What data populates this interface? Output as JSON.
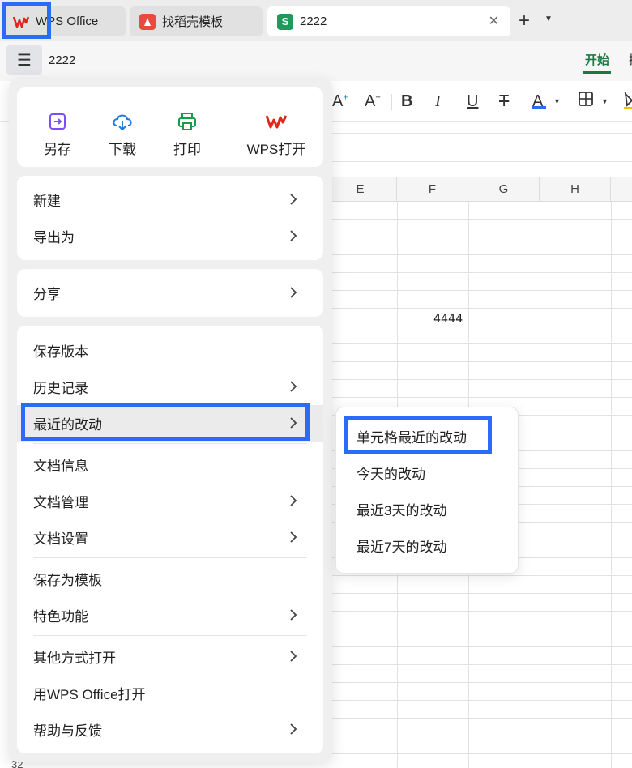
{
  "tabs": [
    {
      "label": "WPS Office",
      "icon": "wps-logo-icon",
      "active": false
    },
    {
      "label": "找稻壳模板",
      "icon": "docer-icon",
      "active": false
    },
    {
      "label": "2222",
      "icon": "spreadsheet-icon",
      "icon_text": "S",
      "active": true
    }
  ],
  "new_tab_symbol": "+",
  "doc_title": "2222",
  "ribbon": {
    "start_tab": "开始",
    "next_tab": "插"
  },
  "colors": {
    "accent": "#2b6cf6",
    "brand_green": "#1a7a43",
    "wps_red": "#e0251b",
    "sheet_green": "#1e9b5a"
  },
  "columns": [
    "E",
    "F",
    "G",
    "H"
  ],
  "cell_value": "4444",
  "row_number": "32",
  "menu": {
    "quick_actions": [
      {
        "label": "另存",
        "icon": "save-as-icon"
      },
      {
        "label": "下载",
        "icon": "download-cloud-icon"
      },
      {
        "label": "打印",
        "icon": "printer-icon"
      },
      {
        "label": "WPS打开",
        "icon": "wps-open-icon"
      }
    ],
    "group1": [
      {
        "label": "新建",
        "submenu": true
      },
      {
        "label": "导出为",
        "submenu": true
      }
    ],
    "group2": [
      {
        "label": "分享",
        "submenu": true
      }
    ],
    "group3": [
      {
        "label": "保存版本",
        "submenu": false
      },
      {
        "label": "历史记录",
        "submenu": true
      },
      {
        "label": "最近的改动",
        "submenu": true,
        "selected": true
      },
      {
        "label": "文档信息",
        "submenu": false
      },
      {
        "label": "文档管理",
        "submenu": true
      },
      {
        "label": "文档设置",
        "submenu": true
      },
      {
        "label": "保存为模板",
        "submenu": false
      },
      {
        "label": "特色功能",
        "submenu": true
      },
      {
        "label": "其他方式打开",
        "submenu": true
      },
      {
        "label": "用WPS Office打开",
        "submenu": false
      },
      {
        "label": "帮助与反馈",
        "submenu": true
      }
    ]
  },
  "submenu": [
    {
      "label": "单元格最近的改动",
      "highlighted": true
    },
    {
      "label": "今天的改动"
    },
    {
      "label": "最近3天的改动"
    },
    {
      "label": "最近7天的改动"
    }
  ]
}
